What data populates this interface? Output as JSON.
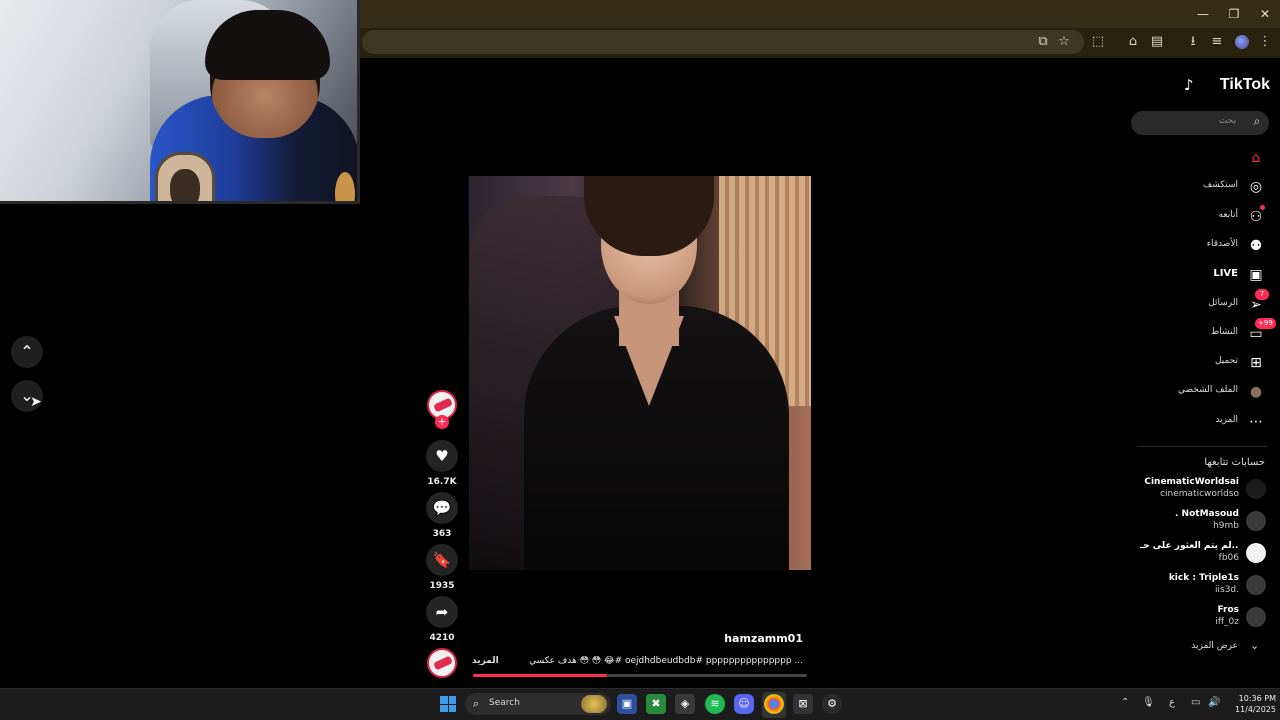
{
  "browser": {
    "window_controls": {
      "minimize": "—",
      "maximize": "❐",
      "close": "✕"
    }
  },
  "tiktok": {
    "logo": "TikTok",
    "search_placeholder": "بحث",
    "nav": [
      {
        "label": "",
        "icon": "home-icon",
        "active": true
      },
      {
        "label": "استكشف",
        "icon": "compass-icon"
      },
      {
        "label": "أتابعه",
        "icon": "user-follow-icon",
        "dot": true
      },
      {
        "label": "الأصدقاء",
        "icon": "friends-icon"
      },
      {
        "label": "LIVE",
        "icon": "live-icon"
      },
      {
        "label": "الرسائل",
        "icon": "send-icon",
        "badge": "7"
      },
      {
        "label": "النشاط",
        "icon": "activity-icon",
        "badge": "+99"
      },
      {
        "label": "تحميل",
        "icon": "upload-icon"
      },
      {
        "label": "الملف الشخصي",
        "icon": "profile-avatar-icon"
      },
      {
        "label": "المزيد",
        "icon": "more-dots-icon"
      }
    ],
    "following_title": "حسابات تتابعها",
    "following": [
      {
        "name": "CinematicWorldsai",
        "handle": "cinematicworldso"
      },
      {
        "name": ". NotMasoud",
        "handle": "h9mb"
      },
      {
        "name": "لم يتم العثور على حـ...",
        "handle": "fb06"
      },
      {
        "name": "kick : Triple1s",
        "handle": "iis3d."
      },
      {
        "name": "Fros",
        "handle": "iff_0z"
      }
    ],
    "see_more": "عرض المزيد",
    "post": {
      "username": "hamzamm01",
      "caption": "هدف عكسي 😳 😳 😂# oejdhdbeudbdb# ppppppppppppppp ...",
      "more": "المزيد",
      "progress": 0.4,
      "likes": "16.7K",
      "comments": "363",
      "saves": "1935",
      "shares": "4210"
    }
  },
  "taskbar": {
    "search_label": "Search",
    "time": "10:36 PM",
    "date": "11/4/2025",
    "lang": "ع"
  },
  "colors": {
    "accent": "#fe2c55",
    "bg": "#000000"
  }
}
